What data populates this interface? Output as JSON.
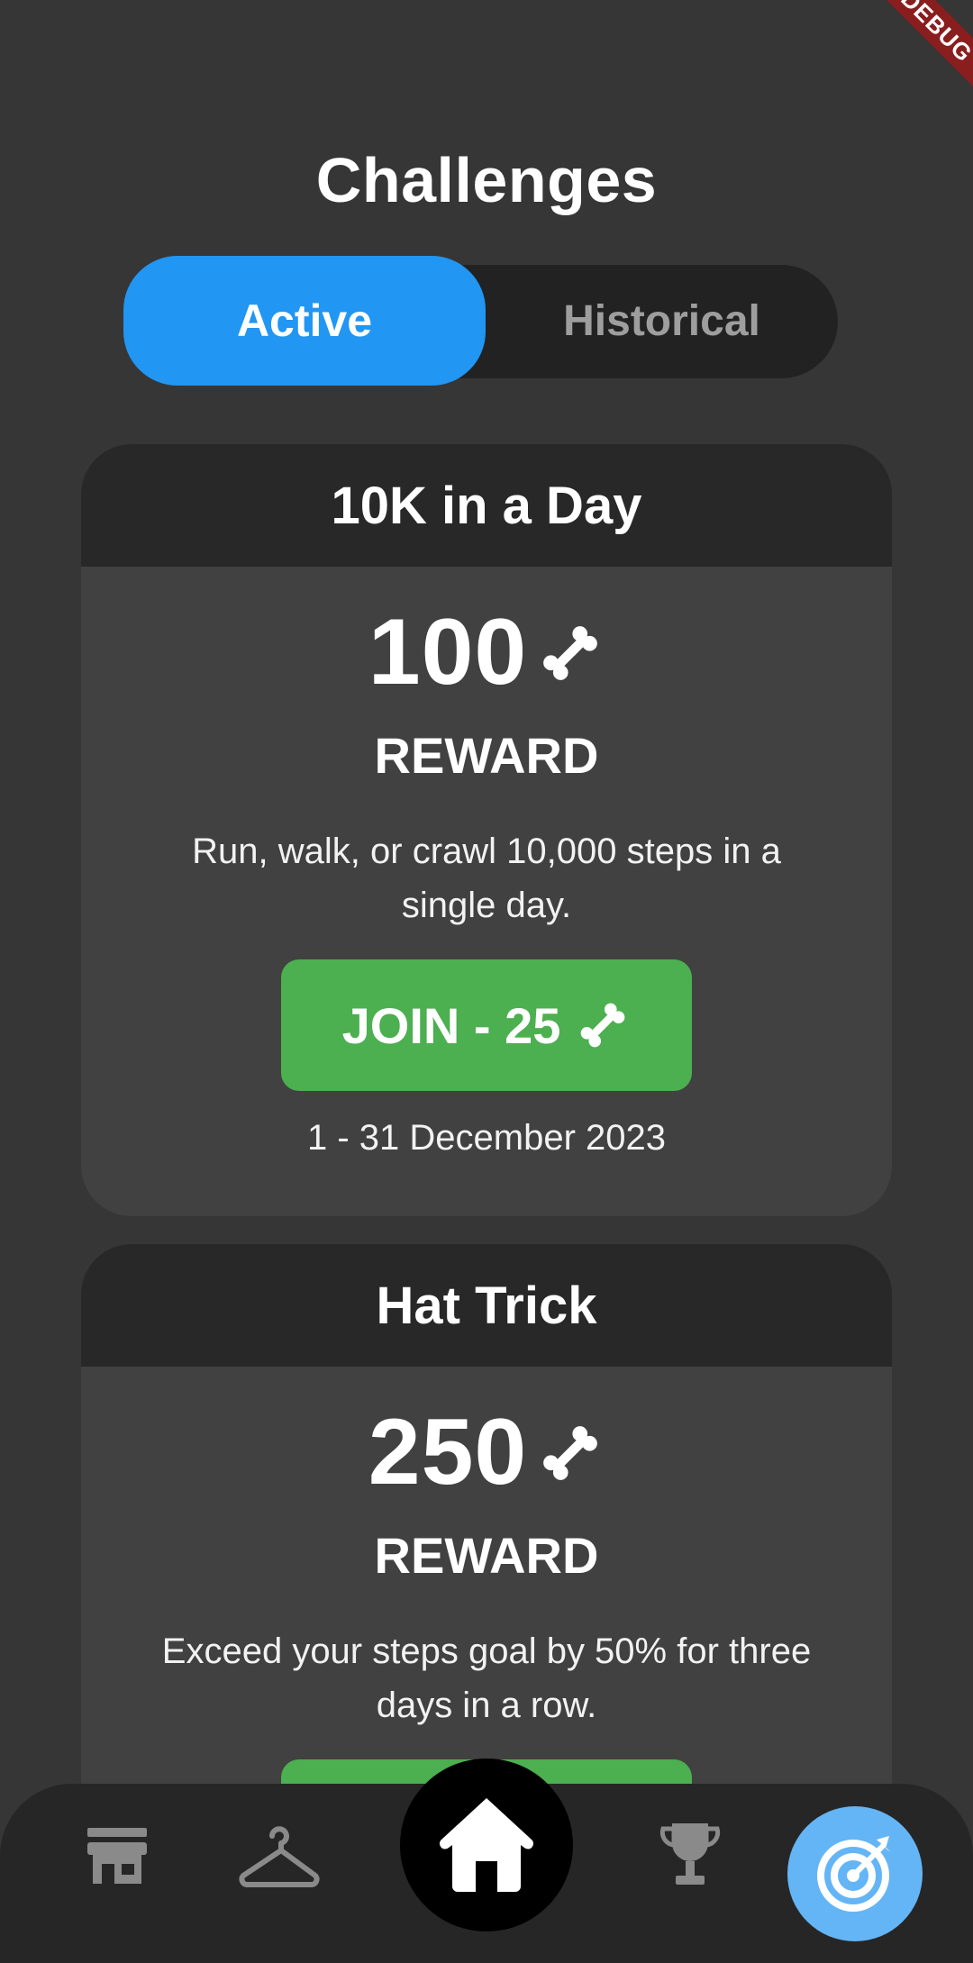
{
  "debug_banner": "DEBUG",
  "page": {
    "title": "Challenges"
  },
  "tabs": {
    "active_label": "Active",
    "historical_label": "Historical"
  },
  "challenges": [
    {
      "title": "10K in a Day",
      "reward_amount": "100",
      "reward_label": "REWARD",
      "description": "Run, walk, or crawl 10,000 steps in a single day.",
      "join_label": "JOIN - 25",
      "dates": "1 - 31 December 2023"
    },
    {
      "title": "Hat Trick",
      "reward_amount": "250",
      "reward_label": "REWARD",
      "description": "Exceed your steps goal by 50% for three days in a row."
    }
  ],
  "bottom_nav": {
    "items": [
      "store-icon",
      "hanger-icon",
      "home-icon",
      "trophy-icon",
      "target-icon"
    ],
    "active": "target-icon"
  },
  "colors": {
    "background": "#363636",
    "accent_blue": "#2196f3",
    "join_green": "#4caf50",
    "nav_active": "#64b5f6"
  }
}
